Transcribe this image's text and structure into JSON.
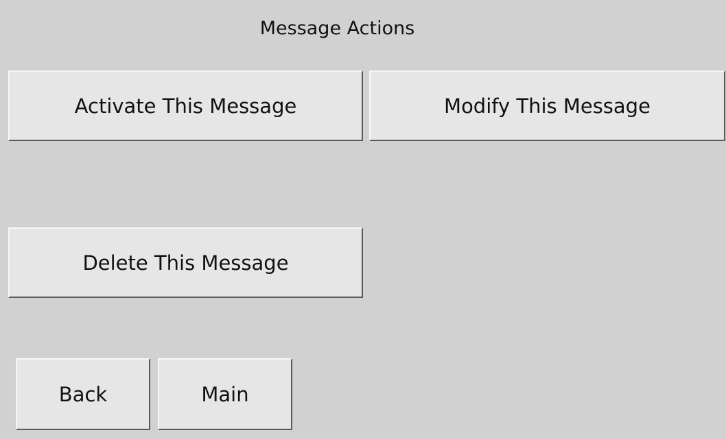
{
  "title": "Message Actions",
  "buttons": {
    "activate": "Activate This Message",
    "modify": "Modify This Message",
    "delete": "Delete This Message",
    "back": "Back",
    "main": "Main"
  },
  "colors": {
    "background": "#d1d1d1",
    "button_face": "#e6e6e6",
    "text": "#111111"
  }
}
